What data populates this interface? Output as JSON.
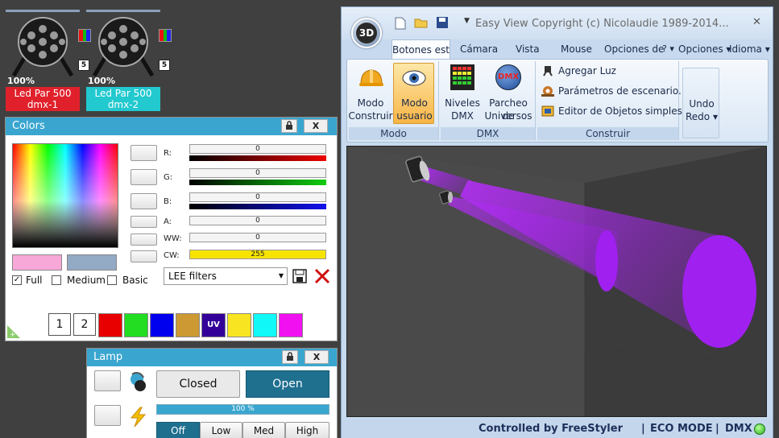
{
  "fixtures": [
    {
      "percent": "100%",
      "name": "Led Par 500",
      "address": "dmx-1",
      "channel_badge": "5",
      "color": "#e0212b"
    },
    {
      "percent": "100%",
      "name": "Led Par 500",
      "address": "dmx-2",
      "channel_badge": "5",
      "color": "#22c9cf"
    }
  ],
  "colors_panel": {
    "title": "Colors",
    "close_label": "X",
    "sliders": [
      {
        "label": "R:",
        "value": "0"
      },
      {
        "label": "G:",
        "value": "0"
      },
      {
        "label": "B:",
        "value": "0"
      },
      {
        "label": "A:",
        "value": "0"
      },
      {
        "label": "WW:",
        "value": "0"
      },
      {
        "label": "CW:",
        "value": "255"
      }
    ],
    "checkboxes": [
      {
        "label": "Full",
        "checked": true
      },
      {
        "label": "Medium",
        "checked": false
      },
      {
        "label": "Basic",
        "checked": false
      }
    ],
    "filter_select": "LEE filters",
    "presets": [
      "1",
      "2"
    ],
    "uv_label": "UV",
    "swatch_colors": [
      "#e80000",
      "#22dd22",
      "#0000ee",
      "#cc9933",
      "#330099",
      "#f8e420",
      "#10f8f8",
      "#f010f0"
    ],
    "preview_colors": [
      "#f8a8d8",
      "#93aac4"
    ]
  },
  "lamp_panel": {
    "title": "Lamp",
    "close_label": "X",
    "closed_label": "Closed",
    "open_label": "Open",
    "progress_label": "100 %",
    "progress": 1.0,
    "levels": [
      "Off",
      "Low",
      "Med",
      "High"
    ]
  },
  "easy_view": {
    "title": "Easy View",
    "copyright": "Copyright (c) Nicolaudie 1989-2014...",
    "close_label": "✕",
    "logo": "3D",
    "tabs": [
      "Botones está",
      "Cámara",
      "Vista",
      "Mouse",
      "Opciones de"
    ],
    "help_label": "? ▾",
    "options_label": "Opciones ▾",
    "language_label": "Idioma ▾",
    "groups": {
      "modo": {
        "label": "Modo",
        "buttons": [
          {
            "line1": "Modo",
            "line2": "Construir"
          },
          {
            "line1": "Modo",
            "line2": "usuario"
          }
        ]
      },
      "dmx": {
        "label": "DMX",
        "buttons": [
          {
            "line1": "Niveles",
            "line2": "DMX"
          },
          {
            "line1": "Parcheo de",
            "line2": "Universos"
          }
        ],
        "dmx_icon_text": "DMX"
      },
      "construir": {
        "label": "Construir",
        "items": [
          "Agregar Luz",
          "Parámetros de escenario...",
          "Editor de Objetos simples"
        ]
      },
      "undo": {
        "line1": "Undo",
        "line2": "Redo ▾"
      }
    },
    "status": {
      "controlled_by": "Controlled by FreeStyler",
      "eco": "ECO MODE",
      "dmx": "DMX ON",
      "sep": "|"
    }
  }
}
